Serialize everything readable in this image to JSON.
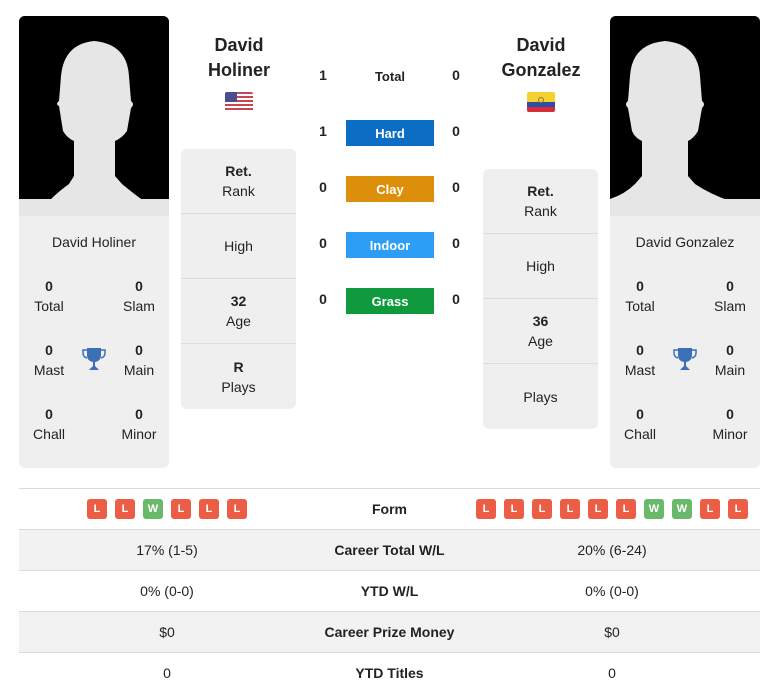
{
  "player1": {
    "heading_first": "David",
    "heading_last": "Holiner",
    "flag": "usa-flag",
    "name": "David Holiner",
    "titles": {
      "total": {
        "value": "0",
        "label": "Total"
      },
      "slam": {
        "value": "0",
        "label": "Slam"
      },
      "mast": {
        "value": "0",
        "label": "Mast"
      },
      "main": {
        "value": "0",
        "label": "Main"
      },
      "chall": {
        "value": "0",
        "label": "Chall"
      },
      "minor": {
        "value": "0",
        "label": "Minor"
      }
    },
    "info": {
      "rank": {
        "value": "Ret.",
        "label": "Rank"
      },
      "high": {
        "value": "",
        "label": "High"
      },
      "age": {
        "value": "32",
        "label": "Age"
      },
      "plays": {
        "value": "R",
        "label": "Plays"
      }
    }
  },
  "player2": {
    "heading_first": "David",
    "heading_last": "Gonzalez",
    "flag": "ecuador-flag",
    "name": "David Gonzalez",
    "titles": {
      "total": {
        "value": "0",
        "label": "Total"
      },
      "slam": {
        "value": "0",
        "label": "Slam"
      },
      "mast": {
        "value": "0",
        "label": "Mast"
      },
      "main": {
        "value": "0",
        "label": "Main"
      },
      "chall": {
        "value": "0",
        "label": "Chall"
      },
      "minor": {
        "value": "0",
        "label": "Minor"
      }
    },
    "info": {
      "rank": {
        "value": "Ret.",
        "label": "Rank"
      },
      "high": {
        "value": "",
        "label": "High"
      },
      "age": {
        "value": "36",
        "label": "Age"
      },
      "plays": {
        "value": "",
        "label": "Plays"
      }
    }
  },
  "h2h": {
    "total": {
      "label": "Total",
      "p1": "1",
      "p2": "0"
    },
    "surfaces": [
      {
        "label": "Hard",
        "p1": "1",
        "p2": "0",
        "color": "#0b6dc3"
      },
      {
        "label": "Clay",
        "p1": "0",
        "p2": "0",
        "color": "#dc8f0b"
      },
      {
        "label": "Indoor",
        "p1": "0",
        "p2": "0",
        "color": "#2d9ef5"
      },
      {
        "label": "Grass",
        "p1": "0",
        "p2": "0",
        "color": "#0e9a3d"
      }
    ]
  },
  "comparison": {
    "form": {
      "label": "Form",
      "p1": [
        "L",
        "L",
        "W",
        "L",
        "L",
        "L"
      ],
      "p2": [
        "L",
        "L",
        "L",
        "L",
        "L",
        "L",
        "W",
        "W",
        "L",
        "L"
      ]
    },
    "rows": [
      {
        "label": "Career Total W/L",
        "p1": "17% (1-5)",
        "p2": "20% (6-24)"
      },
      {
        "label": "YTD W/L",
        "p1": "0% (0-0)",
        "p2": "0% (0-0)"
      },
      {
        "label": "Career Prize Money",
        "p1": "$0",
        "p2": "$0"
      },
      {
        "label": "YTD Titles",
        "p1": "0",
        "p2": "0"
      }
    ]
  },
  "colors": {
    "loss": "#ec5d45",
    "win": "#6ab96a",
    "trophy": "#3b6fb6"
  }
}
